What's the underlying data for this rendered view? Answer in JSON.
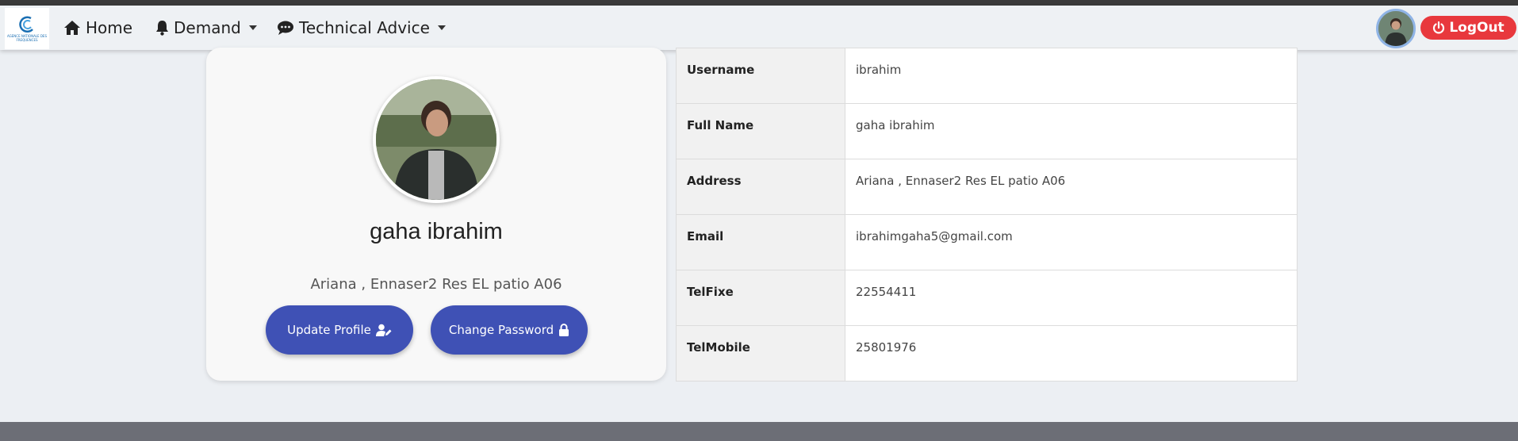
{
  "logo": {
    "text": "AGENCE NATIONALE DES FREQUENCES",
    "brand_color": "#1b6fb3"
  },
  "nav": {
    "home_label": "Home",
    "demand_label": "Demand",
    "technical_advice_label": "Technical Advice",
    "logout_label": "LogOut"
  },
  "icons": {
    "home": "home-icon",
    "demand": "bell-icon",
    "technical_advice": "comments-icon",
    "logout": "power-icon",
    "update_profile": "user-edit-icon",
    "change_password": "lock-icon"
  },
  "profile": {
    "name": "gaha ibrahim",
    "address": "Ariana , Ennaser2 Res EL patio A06",
    "update_button": "Update Profile",
    "password_button": "Change Password"
  },
  "details": [
    {
      "key": "Username",
      "value": "ibrahim"
    },
    {
      "key": "Full Name",
      "value": "gaha ibrahim"
    },
    {
      "key": "Address",
      "value": "Ariana , Ennaser2 Res EL patio A06"
    },
    {
      "key": "Email",
      "value": "ibrahimgaha5@gmail.com"
    },
    {
      "key": "TelFixe",
      "value": "22554411"
    },
    {
      "key": "TelMobile",
      "value": "25801976"
    }
  ],
  "colors": {
    "primary_button": "#3f51b5",
    "logout_button": "#e8383d",
    "navbar": "#eef1f4",
    "background": "#eceff3"
  }
}
